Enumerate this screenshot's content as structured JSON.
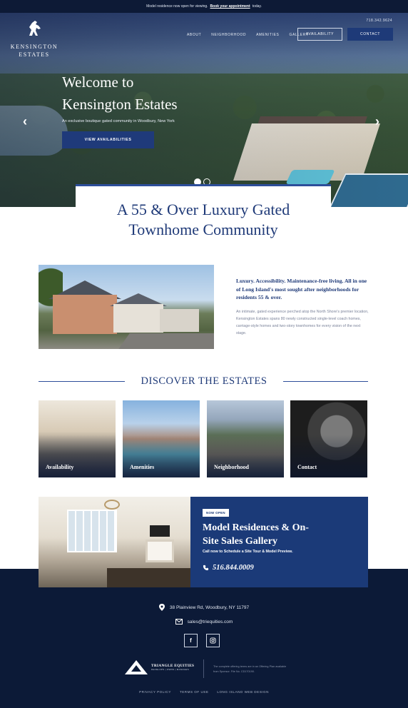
{
  "topbar": {
    "message": "Model residence now open for viewing.",
    "link": "Book your appointment",
    "suffix": "today."
  },
  "brand": {
    "name_line1": "KENSINGTON",
    "name_line2": "ESTATES",
    "logo_icon": "horse-icon"
  },
  "header": {
    "phone": "718.342.9624",
    "nav": [
      "ABOUT",
      "NEIGHBORHOOD",
      "AMENITIES",
      "GALLERY"
    ],
    "availability_button": "AVAILABILITY",
    "contact_button": "CONTACT"
  },
  "hero": {
    "title_line1": "Welcome to",
    "title_line2": "Kensington Estates",
    "subtitle": "An exclusive boutique gated community in Woodbury, New York",
    "cta": "VIEW AVAILABILITIES",
    "prev_icon": "chevron-left-icon",
    "next_icon": "chevron-right-icon",
    "slides": 2,
    "active_slide": 1
  },
  "headline": {
    "line1": "A 55 & Over Luxury Gated",
    "line2": "Townhome Community"
  },
  "intro": {
    "lead": "Luxury. Accessibility. Maintenance-free living. All in one of Long Island's most sought after neighborhoods for residents 55 & over.",
    "body": "An intimate, gated experience perched atop the North Shore's premier location, Kensington Estates spans 80 newly constructed single-level coach homes, carriage-style homes and two-story townhomes for every vision of the next stage."
  },
  "discover": {
    "title": "DISCOVER THE ESTATES",
    "tiles": [
      "Availability",
      "Amenities",
      "Neighborhood",
      "Contact"
    ]
  },
  "model": {
    "badge": "NOW OPEN",
    "title_line1": "Model Residences & On-",
    "title_line2": "Site Sales Gallery",
    "subtitle": "Call now to Schedule a Site Tour & Model Preview.",
    "phone": "516.844.0009",
    "phone_icon": "phone-icon"
  },
  "footer": {
    "address": "38 Plainview Rd, Woodbury, NY 11797",
    "email": "sales@triequities.com",
    "social": [
      "facebook-icon",
      "instagram-icon"
    ],
    "developer_name": "TRIANGLE EQUITIES",
    "developer_tagline": "DEVELOPS | OWNS | MANAGES",
    "disclaimer": "The complete offering terms are in an Offering Plan available from Sponsor. File No. CD170190.",
    "links": [
      "PRIVACY POLICY",
      "TERMS OF USE",
      "LONG ISLAND WEB DESIGN"
    ]
  },
  "colors": {
    "navy": "#0c1a37",
    "accent_blue": "#1f3a78",
    "button_blue": "#1e3a78",
    "white": "#ffffff"
  }
}
